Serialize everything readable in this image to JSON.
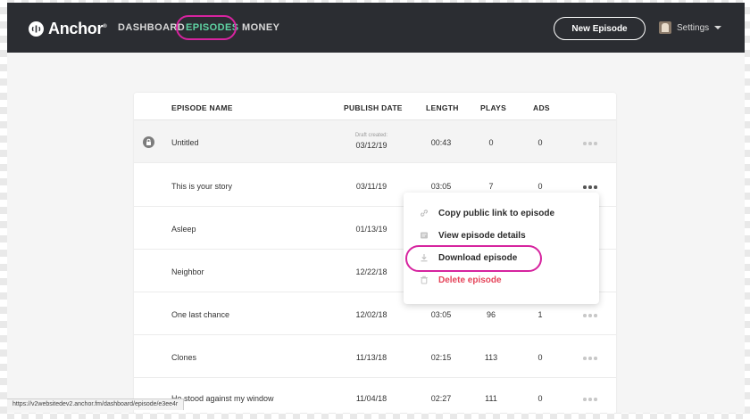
{
  "brand": {
    "name": "Anchor",
    "mark": "®"
  },
  "nav": {
    "items": [
      {
        "label": "DASHBOARD"
      },
      {
        "label": "EPISODES"
      },
      {
        "label": "MONEY"
      }
    ],
    "new_episode": "New Episode",
    "settings": "Settings"
  },
  "table": {
    "headers": {
      "name": "EPISODE NAME",
      "date": "PUBLISH DATE",
      "length": "LENGTH",
      "plays": "PLAYS",
      "ads": "ADS"
    },
    "draft_label": "Draft created:",
    "rows": [
      {
        "name": "Untitled",
        "date": "03/12/19",
        "length": "00:43",
        "plays": "0",
        "ads": "0"
      },
      {
        "name": "This is your story",
        "date": "03/11/19",
        "length": "03:05",
        "plays": "7",
        "ads": "0"
      },
      {
        "name": "Asleep",
        "date": "01/13/19",
        "length": "",
        "plays": "",
        "ads": ""
      },
      {
        "name": "Neighbor",
        "date": "12/22/18",
        "length": "",
        "plays": "",
        "ads": ""
      },
      {
        "name": "One last chance",
        "date": "12/02/18",
        "length": "03:05",
        "plays": "96",
        "ads": "1"
      },
      {
        "name": "Clones",
        "date": "11/13/18",
        "length": "02:15",
        "plays": "113",
        "ads": "0"
      },
      {
        "name": "He stood against my window",
        "date": "11/04/18",
        "length": "02:27",
        "plays": "111",
        "ads": "0"
      }
    ]
  },
  "context_menu": {
    "items": [
      {
        "label": "Copy public link to episode"
      },
      {
        "label": "View episode details"
      },
      {
        "label": "Download episode"
      },
      {
        "label": "Delete episode"
      }
    ]
  },
  "status_url": "https://v2websitedev2.anchor.fm/dashboard/episode/e3ee4r",
  "colors": {
    "nav_bg": "#2b2d32",
    "active_nav": "#5fd3a3",
    "highlight": "#d6249f",
    "danger": "#e5445a"
  }
}
